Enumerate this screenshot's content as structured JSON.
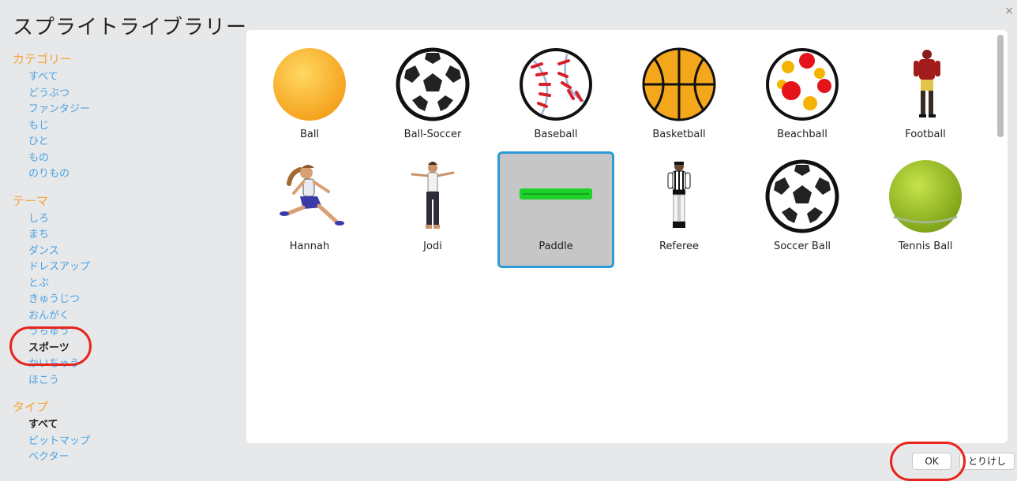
{
  "dialog": {
    "title": "スプライトライブラリー",
    "close_label": "×"
  },
  "sidebar": {
    "category_title": "カテゴリー",
    "categories": [
      "すべて",
      "どうぶつ",
      "ファンタジー",
      "もじ",
      "ひと",
      "もの",
      "のりもの"
    ],
    "theme_title": "テーマ",
    "themes": [
      "しろ",
      "まち",
      "ダンス",
      "ドレスアップ",
      "とぶ",
      "きゅうじつ",
      "おんがく",
      "うちゅう",
      "スポーツ",
      "かいちゅう",
      "ほこう"
    ],
    "active_theme": "スポーツ",
    "type_title": "タイプ",
    "types": [
      "すべて",
      "ビットマップ",
      "ベクター"
    ],
    "active_type": "すべて"
  },
  "sprites": [
    {
      "name": "Ball",
      "icon": "ball-icon"
    },
    {
      "name": "Ball-Soccer",
      "icon": "soccer-ball-icon"
    },
    {
      "name": "Baseball",
      "icon": "baseball-icon"
    },
    {
      "name": "Basketball",
      "icon": "basketball-icon"
    },
    {
      "name": "Beachball",
      "icon": "beachball-icon"
    },
    {
      "name": "Football",
      "icon": "football-player-icon"
    },
    {
      "name": "Hannah",
      "icon": "running-girl-icon"
    },
    {
      "name": "Jodi",
      "icon": "dancing-girl-icon"
    },
    {
      "name": "Paddle",
      "icon": "paddle-icon",
      "selected": true
    },
    {
      "name": "Referee",
      "icon": "referee-icon"
    },
    {
      "name": "Soccer Ball",
      "icon": "soccer-ball-icon"
    },
    {
      "name": "Tennis Ball",
      "icon": "tennis-ball-icon"
    }
  ],
  "buttons": {
    "ok": "OK",
    "cancel": "とりけし"
  },
  "colors": {
    "section": "#f7a53a",
    "link": "#4aa3e5",
    "selection": "#2c9bd6",
    "annotation": "#e8251d"
  }
}
